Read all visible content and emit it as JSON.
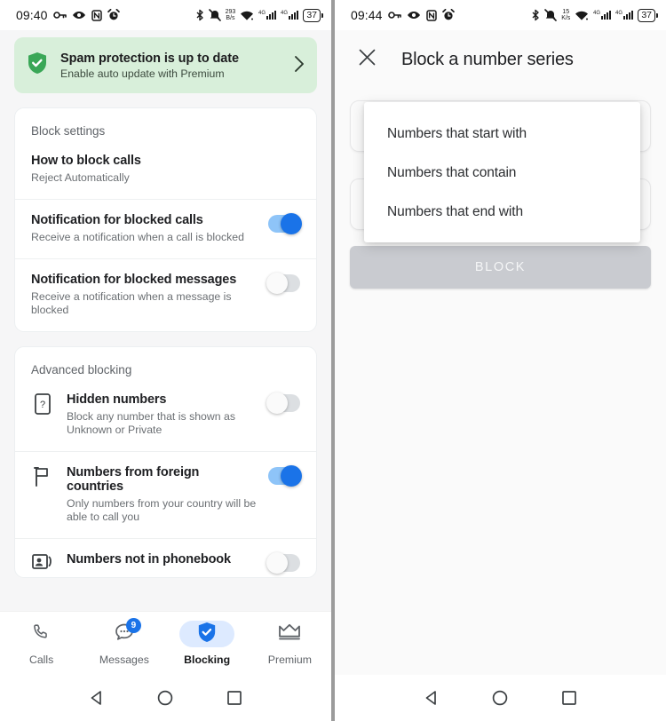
{
  "left": {
    "status": {
      "time": "09:40",
      "icons": [
        "key-icon",
        "eye-icon",
        "nfc-icon",
        "alarm-icon"
      ],
      "right_icons": [
        "bluetooth-icon",
        "mute-icon"
      ],
      "net_speed_value": "293",
      "net_speed_unit": "B/s",
      "wifi": "wifi-icon",
      "sim1": "4G",
      "sim2": "4G",
      "battery": "37"
    },
    "banner": {
      "title": "Spam protection is up to date",
      "subtitle": "Enable auto update with Premium",
      "icon": "shield-check-icon",
      "chevron": "chevron-right-icon",
      "bg_color": "#d8efda"
    },
    "block_settings": {
      "section_title": "Block settings",
      "rows": [
        {
          "title": "How to block calls",
          "subtitle": "Reject Automatically",
          "has_toggle": false
        },
        {
          "title": "Notification for blocked calls",
          "subtitle": "Receive a notification when a call is blocked",
          "has_toggle": true,
          "toggle_on": true
        },
        {
          "title": "Notification for blocked messages",
          "subtitle": "Receive a notification when a message is blocked",
          "has_toggle": true,
          "toggle_on": false
        }
      ]
    },
    "advanced_blocking": {
      "section_title": "Advanced blocking",
      "rows": [
        {
          "icon": "hidden-number-icon",
          "title": "Hidden numbers",
          "subtitle": "Block any number that is shown as Unknown or Private",
          "toggle_on": false
        },
        {
          "icon": "flag-icon",
          "title": "Numbers from foreign countries",
          "subtitle": "Only numbers from your country will be able to call you",
          "toggle_on": true
        },
        {
          "icon": "contact-card-icon",
          "title": "Numbers not in phonebook",
          "subtitle": "",
          "toggle_on": false
        }
      ]
    },
    "bottom_nav": [
      {
        "label": "Calls",
        "icon": "phone-icon",
        "active": false,
        "badge": ""
      },
      {
        "label": "Messages",
        "icon": "message-icon",
        "active": false,
        "badge": "9"
      },
      {
        "label": "Blocking",
        "icon": "shield-check-icon",
        "active": true,
        "badge": ""
      },
      {
        "label": "Premium",
        "icon": "crown-icon",
        "active": false,
        "badge": ""
      }
    ],
    "system_nav": [
      "back-icon",
      "home-icon",
      "recents-icon"
    ]
  },
  "right": {
    "status": {
      "time": "09:44",
      "net_speed_value": "15",
      "net_speed_unit": "K/s",
      "sim1": "4G",
      "sim2": "4G",
      "battery": "37"
    },
    "header": {
      "close": "close-icon",
      "title": "Block a number series"
    },
    "dropdown_options": [
      "Numbers that start with",
      "Numbers that contain",
      "Numbers that end with"
    ],
    "fields": [
      {
        "value": "",
        "placeholder": ""
      },
      {
        "value": "",
        "placeholder": ""
      }
    ],
    "block_button_label": "BLOCK",
    "system_nav": [
      "back-icon",
      "home-icon",
      "recents-icon"
    ]
  },
  "colors": {
    "accent": "#1a73e8",
    "banner_bg": "#d8efda",
    "disabled_button": "#c9cbd0"
  }
}
